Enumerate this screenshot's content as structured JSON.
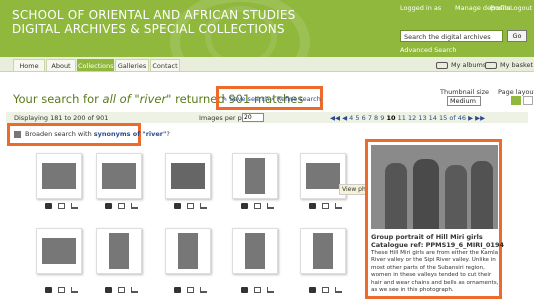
{
  "header": {
    "title_line1": "SCHOOL OF ORIENTAL AND AFRICAN STUDIES",
    "title_line2": "DIGITAL ARCHIVES & SPECIAL COLLECTIONS",
    "logged_in": "Logged in as",
    "manage_deposits": "Manage deposits",
    "profile": "Profile",
    "logout": "Logout",
    "search_value": "Search the digital archives",
    "go_label": "Go",
    "advanced_search": "Advanced Search"
  },
  "nav": {
    "tabs": [
      {
        "label": "Home"
      },
      {
        "label": "About"
      },
      {
        "label": "Collections"
      },
      {
        "label": "Galleries"
      },
      {
        "label": "Contact"
      }
    ],
    "my_albums": "My albums",
    "my_basket": "My basket"
  },
  "results": {
    "prefix": "Your search for ",
    "query_desc": "all of \"river\"",
    "suffix": " returned 901 matches",
    "save_search": "Save search",
    "refine_search": "Refine search",
    "thumbnail_size_label": "Thumbnail size",
    "thumbnail_size_value": "Medium",
    "page_layout_label": "Page layout"
  },
  "pagination": {
    "displaying": "Displaying 181 to 200 of 901",
    "images_per_page_label": "Images per page",
    "images_per_page_value": "20",
    "pages": [
      "4",
      "5",
      "6",
      "7",
      "8",
      "9",
      "10",
      "11",
      "12",
      "13",
      "14",
      "15",
      "of",
      "46"
    ],
    "current_page": "10"
  },
  "broaden": {
    "text": "Broaden search with ",
    "link": "synonyms of \"river\"",
    "end": "?"
  },
  "tooltip": "View photo",
  "detail": {
    "title": "Group portrait of Hill Miri girls",
    "catalogue": "Catalogue ref: PPMS19_6_MIRI_0194",
    "description": "These Hill Miri girls are from either the Kamla River valley or the Sipi River valley. Unlike in most other parts of the Subansiri region, women in these valleys tended to cut their hair and wear chains and bells as ornaments, as we see in this photograph."
  },
  "colors": {
    "header_green": "#8fb83d",
    "highlight_orange": "#ee6a2a",
    "link_blue": "#2c4a8a",
    "heading_green": "#5a7a1a"
  },
  "icons": [
    "camera-icon",
    "album-icon",
    "basket-icon",
    "pencil-icon",
    "magnifier-icon",
    "grid-layout-icon",
    "list-layout-icon",
    "first-page-icon",
    "prev-page-icon",
    "next-page-icon",
    "last-page-icon",
    "broaden-icon"
  ]
}
